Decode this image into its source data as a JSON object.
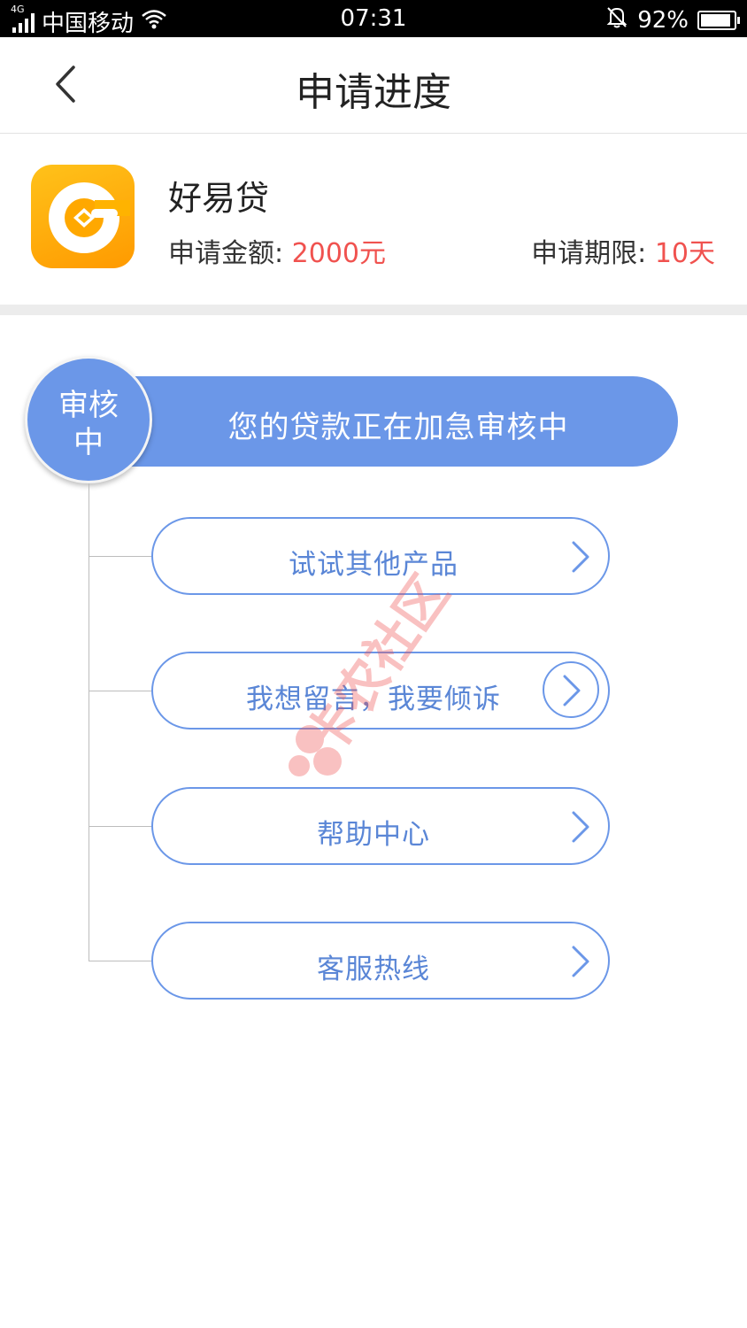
{
  "status_bar": {
    "network": "4G",
    "carrier": "中国移动",
    "time": "07:31",
    "battery": "92%",
    "battery_level": 0.92
  },
  "header": {
    "title": "申请进度"
  },
  "product": {
    "name": "好易贷",
    "amount_label": "申请金额: ",
    "amount_value": "2000元",
    "term_label": "申请期限: ",
    "term_value": "10天",
    "highlight_color": "#f0524f"
  },
  "status": {
    "badge": "审核中",
    "message": "您的贷款正在加急审核中",
    "accent_color": "#6b97e8"
  },
  "options": [
    {
      "label": "试试其他产品",
      "icon": "chevron-right-icon"
    },
    {
      "label": "我想留言，我要倾诉",
      "icon": "chevron-right-circle-icon"
    },
    {
      "label": "帮助中心",
      "icon": "chevron-right-icon"
    },
    {
      "label": "客服热线",
      "icon": "chevron-right-icon"
    }
  ],
  "watermark": "卡农社区"
}
